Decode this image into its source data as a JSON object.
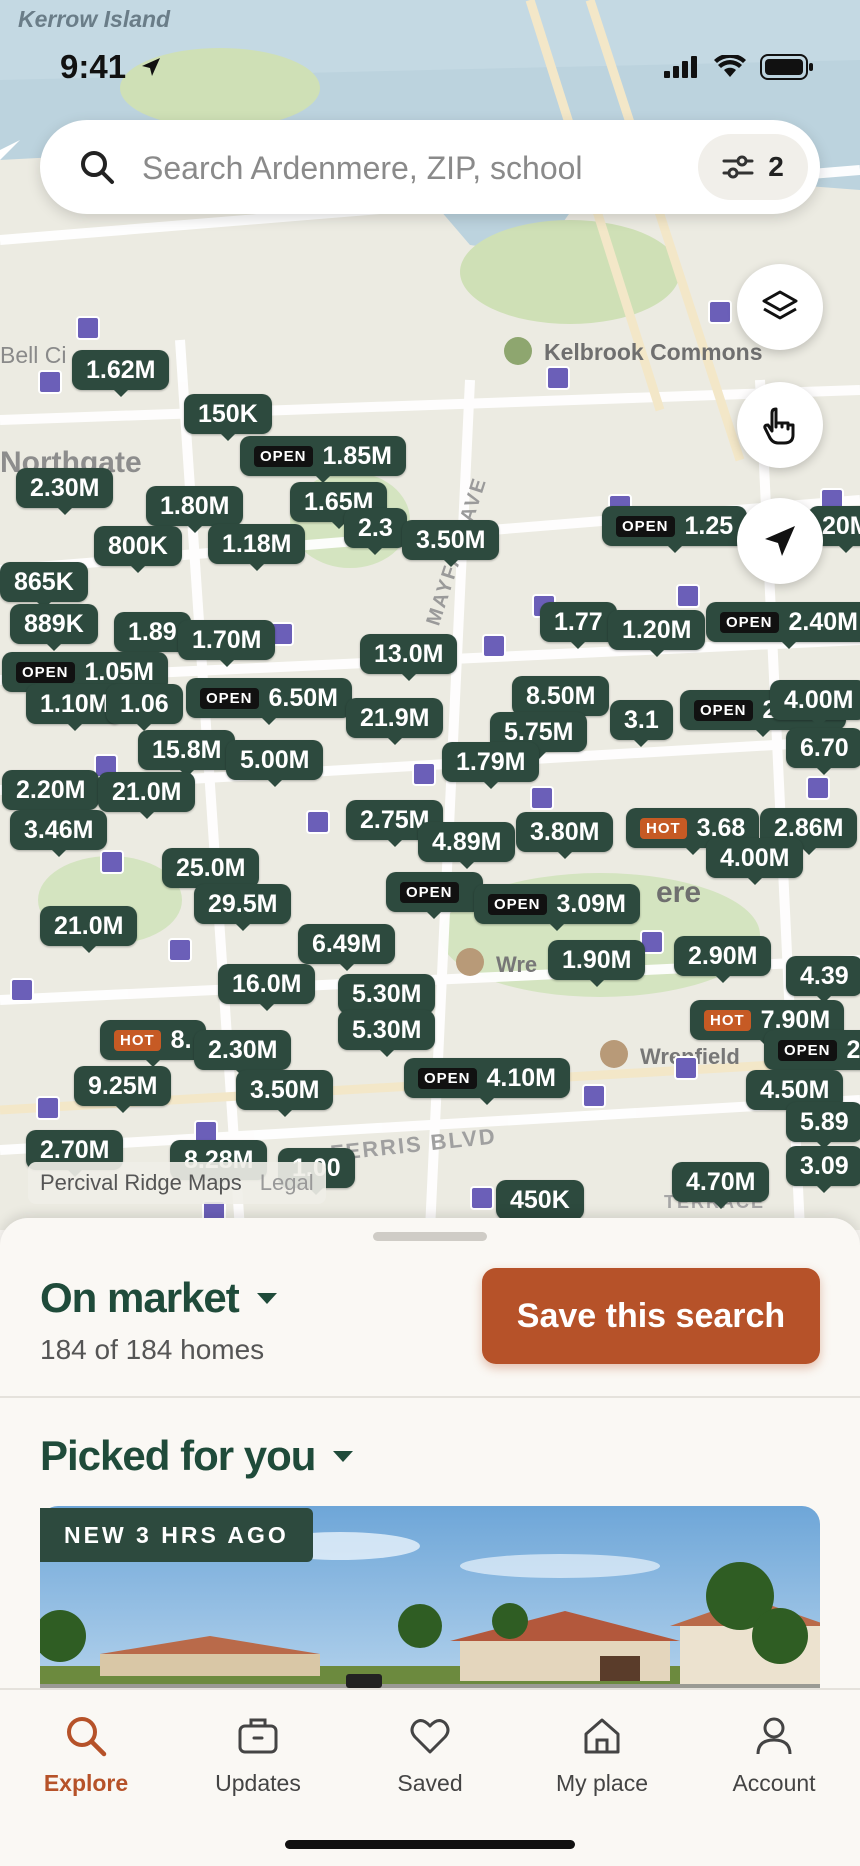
{
  "status": {
    "time": "9:41"
  },
  "map": {
    "labels": {
      "kerrow": "Kerrow Island",
      "northgate": "Northgate",
      "bell": "Bell Ci",
      "kelbrook": "Kelbrook Commons",
      "mayfair": "MAYFAIR AVE",
      "ferris": "FERRIS BLVD",
      "wren1": "Wre",
      "wren2": "Wrenfield",
      "terrace": "TERRACE",
      "ere": "ere"
    },
    "attribution": "Percival Ridge Maps",
    "legal": "Legal",
    "pins": [
      {
        "label": "1.62M",
        "tag": ""
      },
      {
        "label": "150K",
        "tag": ""
      },
      {
        "label": "1.85M",
        "tag": "OPEN"
      },
      {
        "label": "2.30M",
        "tag": ""
      },
      {
        "label": "1.80M",
        "tag": ""
      },
      {
        "label": "1.65M",
        "tag": ""
      },
      {
        "label": "800K",
        "tag": ""
      },
      {
        "label": "1.18M",
        "tag": ""
      },
      {
        "label": "2.3",
        "tag": ""
      },
      {
        "label": "3.50M",
        "tag": ""
      },
      {
        "label": "1.25",
        "tag": "OPEN"
      },
      {
        "label": "20M",
        "tag": ""
      },
      {
        "label": "865K",
        "tag": ""
      },
      {
        "label": "889K",
        "tag": ""
      },
      {
        "label": "1.89",
        "tag": ""
      },
      {
        "label": "1.70M",
        "tag": ""
      },
      {
        "label": "1.77",
        "tag": ""
      },
      {
        "label": "1.20M",
        "tag": ""
      },
      {
        "label": "2.40M",
        "tag": "OPEN"
      },
      {
        "label": "1.05M",
        "tag": "OPEN"
      },
      {
        "label": "1.10M",
        "tag": ""
      },
      {
        "label": "1.06",
        "tag": ""
      },
      {
        "label": "6.50M",
        "tag": "OPEN"
      },
      {
        "label": "13.0M",
        "tag": ""
      },
      {
        "label": "8.50M",
        "tag": ""
      },
      {
        "label": "21.9M",
        "tag": ""
      },
      {
        "label": "5.75M",
        "tag": ""
      },
      {
        "label": "3.1",
        "tag": ""
      },
      {
        "label": "2.50M",
        "tag": "OPEN"
      },
      {
        "label": "4.00M",
        "tag": ""
      },
      {
        "label": "15.8M",
        "tag": ""
      },
      {
        "label": "5.00M",
        "tag": ""
      },
      {
        "label": "1.79M",
        "tag": ""
      },
      {
        "label": "6.70",
        "tag": ""
      },
      {
        "label": "2.20M",
        "tag": ""
      },
      {
        "label": "21.0M",
        "tag": ""
      },
      {
        "label": "3.46M",
        "tag": ""
      },
      {
        "label": "2.75M",
        "tag": ""
      },
      {
        "label": "4.89M",
        "tag": ""
      },
      {
        "label": "3.80M",
        "tag": ""
      },
      {
        "label": "3.68",
        "tag": "HOT"
      },
      {
        "label": "2.86M",
        "tag": ""
      },
      {
        "label": "4.00M",
        "tag": ""
      },
      {
        "label": "25.0M",
        "tag": ""
      },
      {
        "label": "29.5M",
        "tag": ""
      },
      {
        "label": "",
        "tag": "OPEN"
      },
      {
        "label": "3.09M",
        "tag": "OPEN"
      },
      {
        "label": "21.0M",
        "tag": ""
      },
      {
        "label": "6.49M",
        "tag": ""
      },
      {
        "label": "1.90M",
        "tag": ""
      },
      {
        "label": "2.90M",
        "tag": ""
      },
      {
        "label": "4.39",
        "tag": ""
      },
      {
        "label": "16.0M",
        "tag": ""
      },
      {
        "label": "5.30M",
        "tag": ""
      },
      {
        "label": "5.30M",
        "tag": ""
      },
      {
        "label": "8.",
        "tag": "HOT"
      },
      {
        "label": "2.30M",
        "tag": ""
      },
      {
        "label": "7.90M",
        "tag": "HOT"
      },
      {
        "label": "2.",
        "tag": "OPEN"
      },
      {
        "label": "4.10M",
        "tag": "OPEN"
      },
      {
        "label": "9.25M",
        "tag": ""
      },
      {
        "label": "3.50M",
        "tag": ""
      },
      {
        "label": "4.50M",
        "tag": ""
      },
      {
        "label": "5.89",
        "tag": ""
      },
      {
        "label": "2.70M",
        "tag": ""
      },
      {
        "label": "8.28M",
        "tag": ""
      },
      {
        "label": "1.00",
        "tag": ""
      },
      {
        "label": "3.09",
        "tag": ""
      },
      {
        "label": "450K",
        "tag": ""
      },
      {
        "label": "4.70M",
        "tag": ""
      }
    ]
  },
  "search": {
    "placeholder": "Search Ardenmere, ZIP, school",
    "filter_count": "2"
  },
  "sheet": {
    "market_title": "On market",
    "count_text": "184 of 184 homes",
    "save_label": "Save this search",
    "picked_title": "Picked for you",
    "badge": "NEW 3 HRS AGO"
  },
  "tabs": [
    {
      "label": "Explore",
      "icon": "search-icon",
      "active": true
    },
    {
      "label": "Updates",
      "icon": "briefcase-icon",
      "active": false
    },
    {
      "label": "Saved",
      "icon": "heart-icon",
      "active": false
    },
    {
      "label": "My place",
      "icon": "house-icon",
      "active": false
    },
    {
      "label": "Account",
      "icon": "person-icon",
      "active": false
    }
  ],
  "colors": {
    "accent": "#b65229",
    "brand": "#1f4b3a",
    "pin": "#2d4a3e",
    "dot": "#6b5fb8",
    "hot": "#c65a24"
  }
}
